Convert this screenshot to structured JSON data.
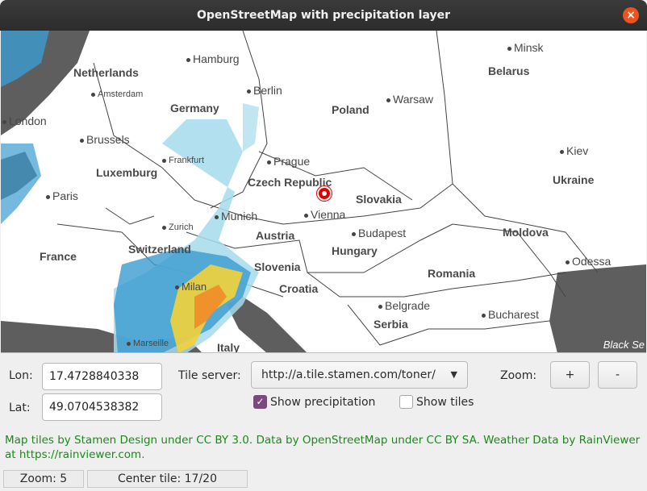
{
  "window": {
    "title": "OpenStreetMap with precipitation layer"
  },
  "map": {
    "countries": [
      "Netherlands",
      "Germany",
      "Poland",
      "Belarus",
      "Czech Republic",
      "Luxemburg",
      "Slovakia",
      "Ukraine",
      "Austria",
      "Hungary",
      "Moldova",
      "France",
      "Switzerland",
      "Slovenia",
      "Romania",
      "Croatia",
      "Serbia",
      "Italy"
    ],
    "cities": [
      "Hamburg",
      "Amsterdam",
      "Berlin",
      "Minsk",
      "Warsaw",
      "London",
      "Brussels",
      "Prague",
      "Kiev",
      "Frankfurt",
      "Paris",
      "Munich",
      "Vienna",
      "Budapest",
      "Zurich",
      "Odessa",
      "Milan",
      "Belgrade",
      "Bucharest",
      "Marseille"
    ],
    "brand": "Black Se",
    "marker_icon": "location-marker-icon",
    "colors": {
      "water": "#5e5e5e",
      "rain_light": "#a6dbec",
      "rain_medium": "#3b9bd0",
      "rain_heavy": "#f2d23a",
      "rain_extreme": "#f28c28"
    }
  },
  "controls": {
    "lon_label": "Lon:",
    "lon_value": "17.4728840338",
    "lat_label": "Lat:",
    "lat_value": "49.0704538382",
    "tile_server_label": "Tile server:",
    "tile_server_value": "http://a.tile.stamen.com/toner/",
    "zoom_label": "Zoom:",
    "zoom_in": "+",
    "zoom_out": "-",
    "show_precipitation_label": "Show precipitation",
    "show_precipitation_checked": true,
    "show_tiles_label": "Show tiles",
    "show_tiles_checked": false
  },
  "attribution": "Map tiles by Stamen Design under CC BY 3.0. Data by OpenStreetMap under CC BY SA. Weather Data by RainViewer at https://rainviewer.com.",
  "status": {
    "zoom": "Zoom: 5",
    "center_tile": "Center tile: 17/20"
  }
}
